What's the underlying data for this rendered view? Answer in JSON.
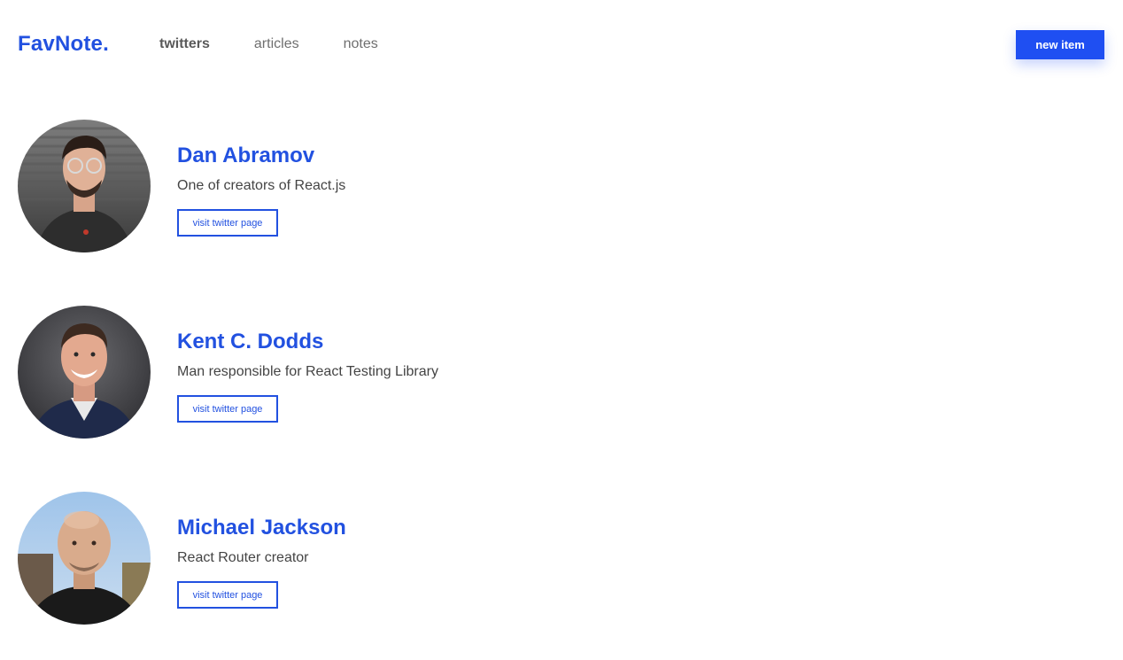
{
  "header": {
    "logo": "FavNote.",
    "nav": [
      {
        "label": "twitters",
        "active": true
      },
      {
        "label": "articles",
        "active": false
      },
      {
        "label": "notes",
        "active": false
      }
    ],
    "new_item_label": "new item"
  },
  "colors": {
    "accent": "#2251e0",
    "button": "#1f4ff2"
  },
  "cards": [
    {
      "name": "Dan Abramov",
      "description": "One of creators of React.js",
      "button_label": "visit twitter page",
      "avatar_icon": "avatar-photo"
    },
    {
      "name": "Kent C. Dodds",
      "description": "Man responsible for React Testing Library",
      "button_label": "visit twitter page",
      "avatar_icon": "avatar-photo"
    },
    {
      "name": "Michael Jackson",
      "description": "React Router creator",
      "button_label": "visit twitter page",
      "avatar_icon": "avatar-photo"
    }
  ]
}
